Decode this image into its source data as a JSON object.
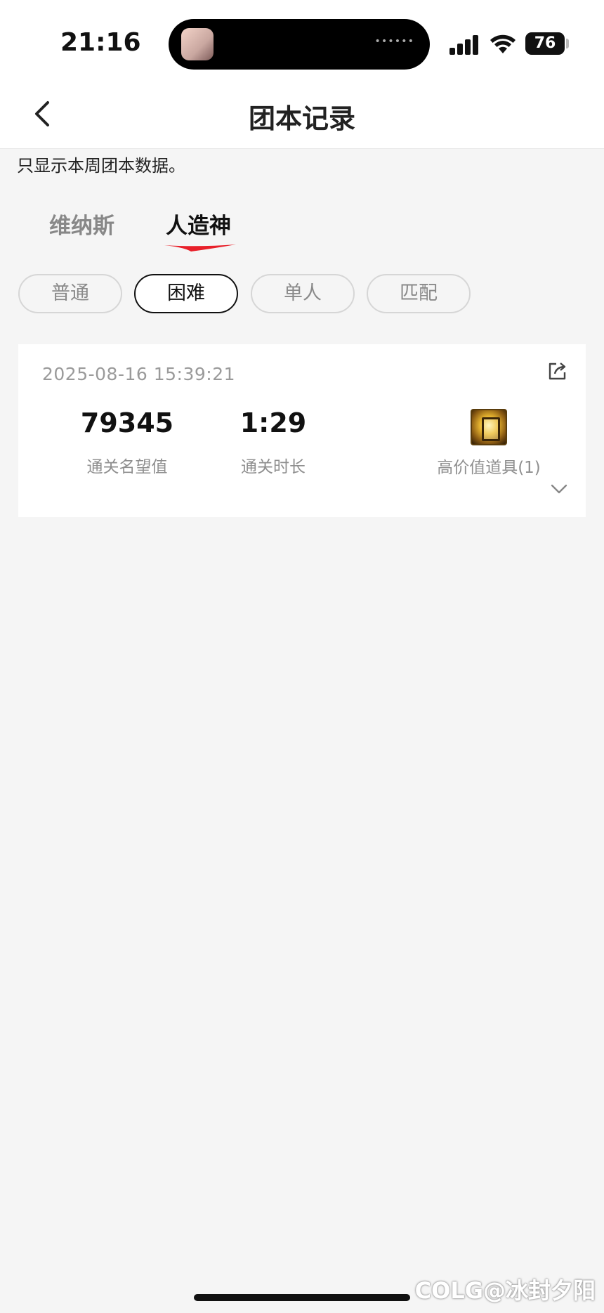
{
  "status_bar": {
    "time": "21:16",
    "battery": "76"
  },
  "header": {
    "title": "团本记录"
  },
  "notice": "只显示本周团本数据。",
  "boss_tabs": [
    {
      "label": "维纳斯",
      "active": false
    },
    {
      "label": "人造神",
      "active": true
    }
  ],
  "difficulty_pills": [
    {
      "label": "普通",
      "active": false
    },
    {
      "label": "困难",
      "active": true
    },
    {
      "label": "单人",
      "active": false
    },
    {
      "label": "匹配",
      "active": false
    }
  ],
  "record": {
    "timestamp": "2025-08-16 15:39:21",
    "reputation_value": "79345",
    "reputation_label": "通关名望值",
    "clear_time_value": "1:29",
    "clear_time_label": "通关时长",
    "item_label": "高价值道具(1)"
  },
  "watermark": "COLG@冰封夕阳",
  "colors": {
    "accent_red": "#e8202a",
    "active_border": "#111111",
    "background": "#f5f5f5"
  }
}
